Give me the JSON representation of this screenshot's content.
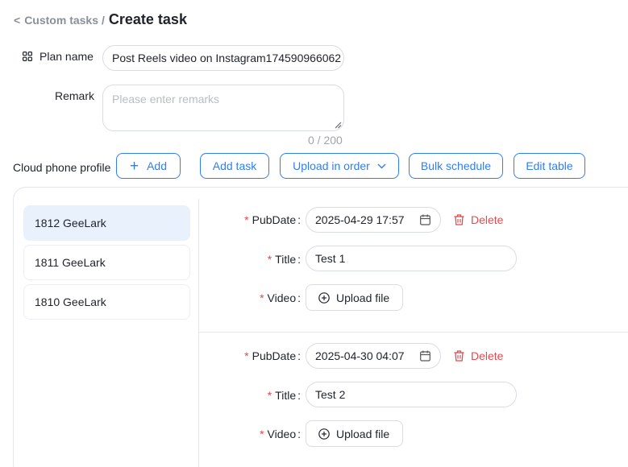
{
  "breadcrumb": {
    "back": "<",
    "parent": "Custom tasks",
    "separator": "/",
    "current": "Create task"
  },
  "plan": {
    "label": "Plan name",
    "value": "Post Reels video on Instagram174590966062"
  },
  "remark": {
    "label": "Remark",
    "placeholder": "Please enter remarks",
    "count": "0 / 200"
  },
  "toolbar": {
    "label": "Cloud phone profile",
    "add_label": "Add",
    "add_task_label": "Add task",
    "upload_order_label": "Upload in order",
    "bulk_schedule_label": "Bulk schedule",
    "edit_table_label": "Edit table"
  },
  "profiles": [
    "1812 GeeLark",
    "1811 GeeLark",
    "1810 GeeLark"
  ],
  "tasks": [
    {
      "pubdate_label": "PubDate",
      "pubdate": "2025-04-29 17:57",
      "title_label": "Title",
      "title": "Test 1",
      "video_label": "Video",
      "upload_label": "Upload file",
      "delete_label": "Delete"
    },
    {
      "pubdate_label": "PubDate",
      "pubdate": "2025-04-30 04:07",
      "title_label": "Title",
      "title": "Test 2",
      "video_label": "Video",
      "upload_label": "Upload file",
      "delete_label": "Delete"
    }
  ],
  "required_mark": "*",
  "colors": {
    "accent": "#2f7ef5",
    "danger": "#e5484d",
    "active_bg": "#e9f1fd",
    "border": "#d9dce1"
  }
}
